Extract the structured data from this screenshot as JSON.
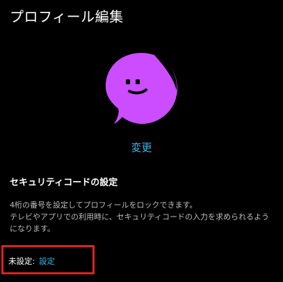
{
  "page": {
    "title": "プロフィール編集"
  },
  "avatar": {
    "icon": "ghost-face-avatar",
    "background_color": "#cc4dff",
    "face_color": "#000000"
  },
  "change_label": "変更",
  "security": {
    "title": "セキュリティコードの設定",
    "description_line1": "4桁の番号を設定してプロフィールをロックできます。",
    "description_line2": "テレビやアプリでの利用時に、セキュリティコードの入力を求められるようになります。",
    "status_label": "未設定:",
    "set_link": "設定"
  },
  "colors": {
    "accent": "#38b6f0",
    "highlight_border": "#e02020"
  }
}
